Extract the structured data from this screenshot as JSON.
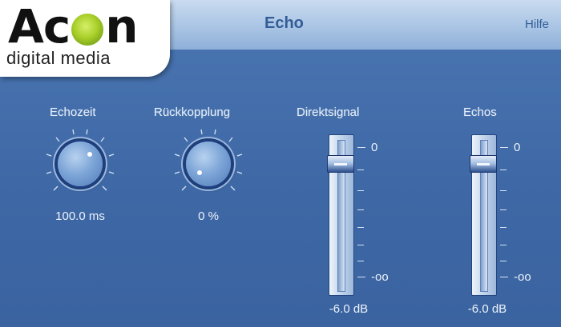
{
  "header": {
    "logo_word_1": "Ac",
    "logo_word_2": "n",
    "logo_sub": "digital media",
    "title": "Echo",
    "help": "Hilfe"
  },
  "knobs": [
    {
      "label": "Echozeit",
      "value": "100.0 ms"
    },
    {
      "label": "Rückkopplung",
      "value": "0 %"
    }
  ],
  "faders": [
    {
      "label": "Direktsignal",
      "top_scale": "0",
      "bottom_scale": "-oo",
      "value": "-6.0 dB"
    },
    {
      "label": "Echos",
      "top_scale": "0",
      "bottom_scale": "-oo",
      "value": "-6.0 dB"
    }
  ],
  "colors": {
    "background": "#3f6aa6",
    "header": "#b3cae8",
    "title": "#335d97",
    "logo_green": "#a9cf2a",
    "text": "#e3ecf8"
  },
  "icons": [
    "knob-control-icon",
    "fader-handle-icon"
  ]
}
